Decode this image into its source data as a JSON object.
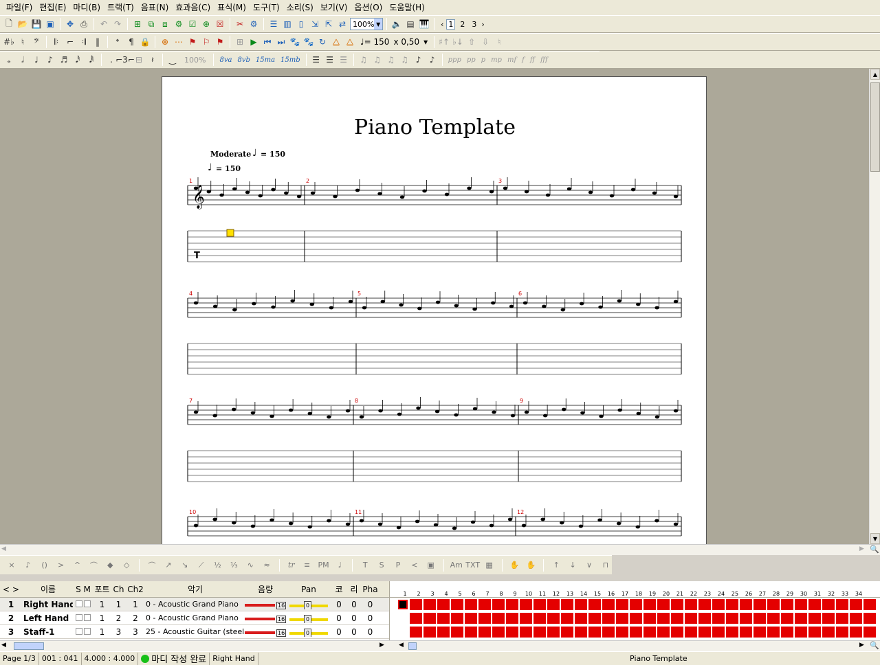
{
  "menu": [
    "파일(F)",
    "편집(E)",
    "마디(B)",
    "트랙(T)",
    "음표(N)",
    "효과음(C)",
    "표식(M)",
    "도구(T)",
    "소리(S)",
    "보기(V)",
    "옵션(O)",
    "도움말(H)"
  ],
  "toolbar": {
    "pages": [
      "1",
      "2",
      "3"
    ],
    "zoom": "100%",
    "tempo": "♩= 150",
    "speed": "x 0,50",
    "pct": "100%"
  },
  "score": {
    "title": "Piano Template",
    "tempo_marking": "Moderate",
    "tempo_value": "= 150",
    "tempo_value2": "= 150",
    "measures": [
      "1",
      "2",
      "3",
      "4",
      "5",
      "6",
      "7",
      "8",
      "9",
      "10",
      "11",
      "12"
    ]
  },
  "tracks": {
    "headers": {
      "nav": "< >",
      "name": "이름",
      "sm": "S M",
      "port": "포트",
      "ch": "Ch",
      "ch2": "Ch2",
      "inst": "악기",
      "vol": "음량",
      "pan": "Pan",
      "cho": "코",
      "rev": "리",
      "pha": "Pha"
    },
    "rows": [
      {
        "num": "1",
        "name": "Right Hand",
        "port": "1",
        "ch": "1",
        "ch2": "1",
        "inst": "0 - Acoustic Grand Piano",
        "vol": "16",
        "pan": "0",
        "cho": "0",
        "rev": "0",
        "pha": "0"
      },
      {
        "num": "2",
        "name": "Left Hand",
        "port": "1",
        "ch": "2",
        "ch2": "2",
        "inst": "0 - Acoustic Grand Piano",
        "vol": "16",
        "pan": "0",
        "cho": "0",
        "rev": "0",
        "pha": "0"
      },
      {
        "num": "3",
        "name": "Staff-1",
        "port": "1",
        "ch": "3",
        "ch2": "3",
        "inst": "25 - Acoustic Guitar (steel)",
        "vol": "16",
        "pan": "0",
        "cho": "0",
        "rev": "0",
        "pha": "0"
      }
    ],
    "bar_numbers": [
      "1",
      "2",
      "3",
      "4",
      "5",
      "6",
      "7",
      "8",
      "9",
      "10",
      "11",
      "12",
      "13",
      "14",
      "15",
      "16",
      "17",
      "18",
      "19",
      "20",
      "21",
      "22",
      "23",
      "24",
      "25",
      "26",
      "27",
      "28",
      "29",
      "30",
      "31",
      "32",
      "33",
      "34"
    ]
  },
  "status": {
    "page": "Page 1/3",
    "position": "001 : 041",
    "signature": "4.000 : 4.000",
    "midi": "마디 작성 완료",
    "track": "Right Hand",
    "file": "Piano Template"
  },
  "colors": {
    "bar_fill": "#e40000",
    "vol": "#d81c1c",
    "pan": "#f0d800",
    "ok": "#18c018"
  }
}
